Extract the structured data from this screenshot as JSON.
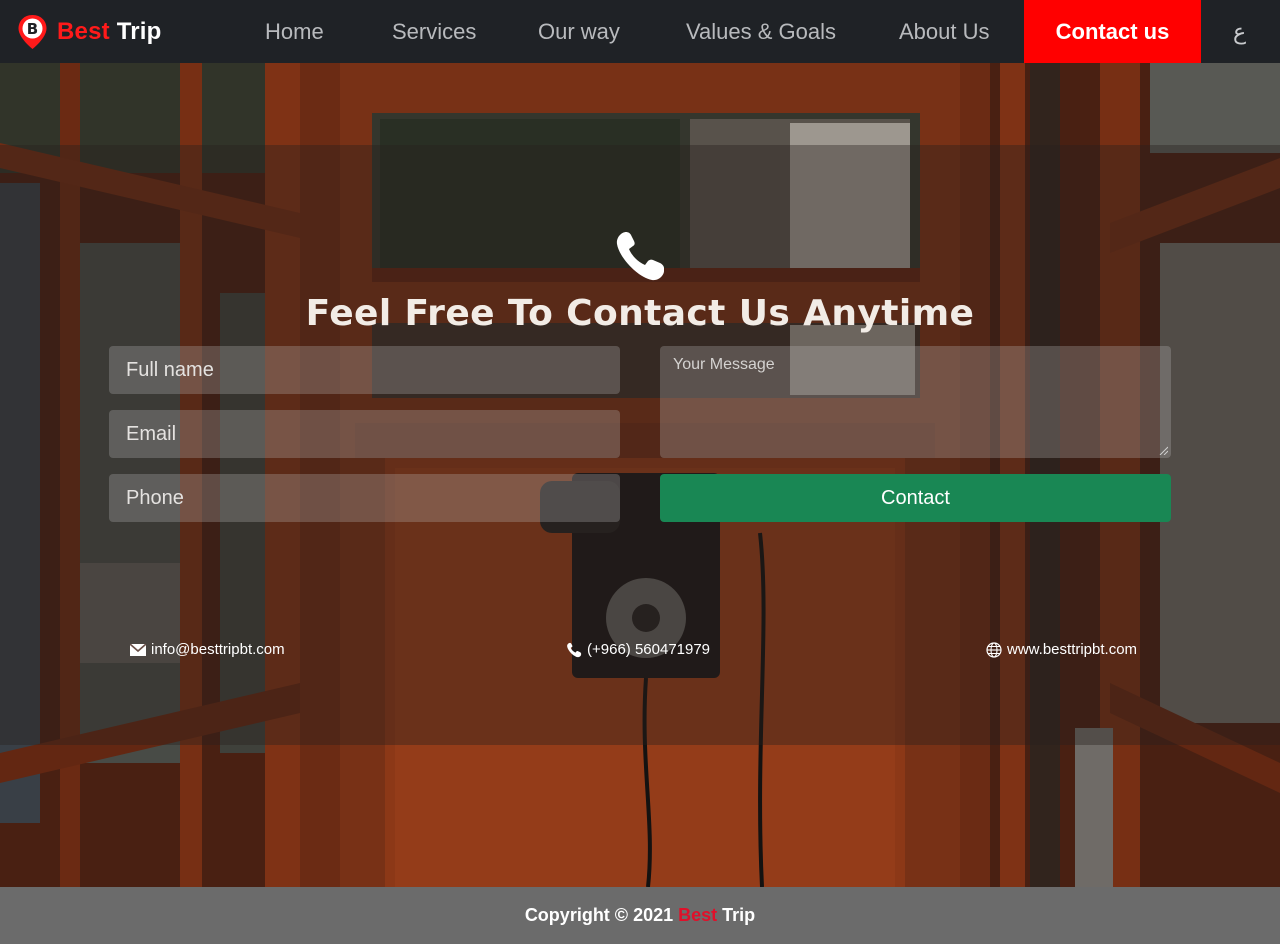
{
  "brand": {
    "best": "Best",
    "trip": "Trip",
    "logo_letter": "B",
    "accent_color": "#ff0000"
  },
  "nav": {
    "home": "Home",
    "services": "Services",
    "our_way": "Our way",
    "values_goals": "Values & Goals",
    "about_us": "About Us",
    "contact_us": "Contact us",
    "language": "ع"
  },
  "hero": {
    "icon": "phone-icon",
    "headline": "Feel Free To Contact Us Anytime"
  },
  "form": {
    "full_name_placeholder": "Full name",
    "email_placeholder": "Email",
    "phone_placeholder": "Phone",
    "message_placeholder": "Your Message",
    "submit_label": "Contact",
    "submit_color": "#198754"
  },
  "contact_info": {
    "email": "info@besttripbt.com",
    "phone": "(+966) 560471979",
    "website": "www.besttripbt.com"
  },
  "footer": {
    "copyright_prefix": "Copyright © 2021",
    "best": "Best",
    "trip": "Trip"
  }
}
